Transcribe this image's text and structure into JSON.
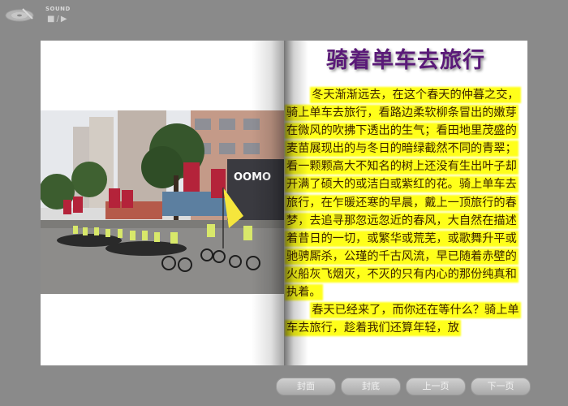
{
  "sound": {
    "label": "SOUND",
    "controls": [
      "■",
      "/",
      "▶"
    ]
  },
  "article": {
    "title": "骑着单车去旅行",
    "paragraphs": [
      "冬天渐渐远去，在这个春天的仲暮之交，骑上单车去旅行，看路边柔软柳条冒出的嫩芽在微风的吹拂下透出的生气；看田地里茂盛的麦苗展现出的与冬日的暗绿截然不同的青翠；看一颗颗高大不知名的树上还没有生出叶子却开满了硕大的或洁白或紫红的花。骑上单车去旅行，在乍暖还寒的早晨，戴上一顶旅行的春梦，去追寻那忽远忽近的春风，大自然在描述着昔日的一切，或繁华或荒芜，或歌舞升平或驰骋厮杀，公瑾的千古风流，早已随着赤壁的火船灰飞烟灭，不灭的只有内心的那份纯真和执着。",
      "春天已经来了，而你还在等什么？骑上单车去旅行，趁着我们还算年轻，放"
    ]
  },
  "photo": {
    "storefront_text": "OOMO"
  },
  "nav": {
    "cover": "封面",
    "back_cover": "封底",
    "prev": "上一页",
    "next": "下一页"
  },
  "colors": {
    "background": "#8a8a8a",
    "highlight": "#ffff1a",
    "title": "#5a1a78"
  }
}
